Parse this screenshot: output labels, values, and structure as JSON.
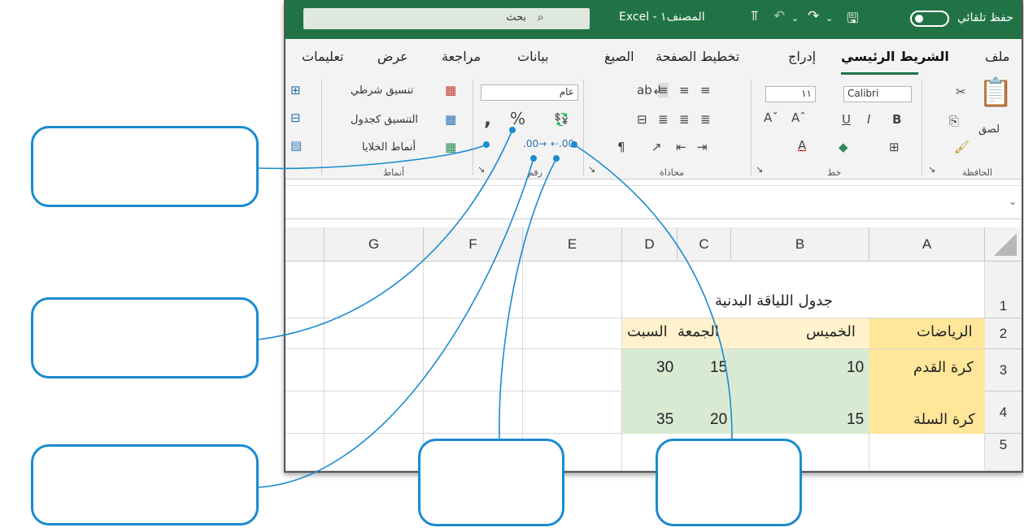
{
  "titlebar": {
    "autosave_label": "حفظ تلقائي",
    "title": "المصنف١ - Excel",
    "search_placeholder": "بحث"
  },
  "tabs": [
    "ملف",
    "الشريط الرئيسي",
    "إدراج",
    "تخطيط الصفحة",
    "الصيغ",
    "بيانات",
    "مراجعة",
    "عرض",
    "تعليمات"
  ],
  "ribbon": {
    "clipboard": {
      "paste_label": "لصق",
      "group_label": "الحافظة"
    },
    "font": {
      "font_name": "Calibri",
      "font_size": "١١",
      "group_label": "خط"
    },
    "alignment": {
      "group_label": "محاذاة"
    },
    "number": {
      "format": "عام",
      "group_label": "رقم"
    },
    "styles": {
      "conditional_formatting": "تنسيق شرطي",
      "format_as_table": "التنسيق كجدول",
      "cell_styles": "أنماط الخلايا",
      "group_label": "أنماط"
    }
  },
  "sheet": {
    "columns": [
      "A",
      "B",
      "C",
      "D",
      "E",
      "F",
      "G"
    ],
    "rows": [
      "1",
      "2",
      "3",
      "4",
      "5"
    ],
    "title": "جدول اللياقة البدنية",
    "headers": {
      "sport": "الرياضات",
      "thursday": "الخميس",
      "friday": "الجمعة",
      "saturday": "السبت"
    },
    "data": [
      {
        "sport": "كرة القدم",
        "thursday": "10",
        "friday": "15",
        "saturday": "30"
      },
      {
        "sport": "كرة السلة",
        "thursday": "15",
        "friday": "20",
        "saturday": "35"
      }
    ]
  },
  "colors": {
    "excel_green": "#217346",
    "header_yellow": "#ffe699",
    "data_green": "#d9ead3",
    "callout_blue": "#1a8bd0"
  }
}
